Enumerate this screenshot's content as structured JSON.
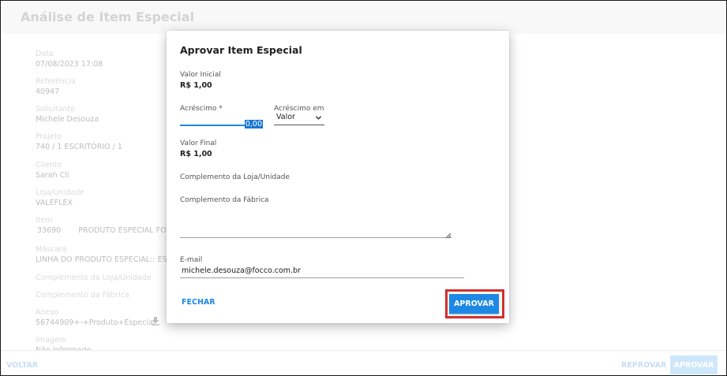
{
  "page": {
    "title": "Análise de Item Especial",
    "fields": [
      {
        "label": "Data",
        "value": "07/08/2023 17:08"
      },
      {
        "label": "Referência",
        "value": "40947"
      },
      {
        "label": "Solicitante",
        "value": "Michele Desouza"
      },
      {
        "label": "Projeto",
        "value": "740 / 1 ESCRITÓRIO / 1"
      },
      {
        "label": "Cliente",
        "value": "Sarah Cli"
      },
      {
        "label": "Loja/Unidade",
        "value": "VALEFLEX"
      }
    ],
    "item": {
      "label": "Item",
      "code": "33690",
      "name": "PRODUTO ESPECIAL FOCCO"
    },
    "mascara": {
      "label": "Máscara",
      "value": "LINHA DO PRODUTO ESPECIAL:: ESPE"
    },
    "complemento_loja": {
      "label": "Complemento da Loja/Unidade"
    },
    "complemento_fabrica": {
      "label": "Complemento da Fábrica"
    },
    "anexo": {
      "label": "Anexo",
      "value": "56744909+-+Produto+Especial"
    },
    "imagem": {
      "label": "Imagem",
      "value": "Não Informado"
    },
    "footer": {
      "voltar_label": "VOLTAR",
      "reprovar_label": "REPROVAR",
      "aprovar_label": "APROVAR"
    }
  },
  "dialog": {
    "title": "Aprovar Item Especial",
    "valor_inicial": {
      "label": "Valor Inicial",
      "value": "R$ 1,00"
    },
    "acrescimo": {
      "label": "Acréscimo *",
      "value": "0,00"
    },
    "acrescimo_em": {
      "label": "Acréscimo em",
      "selected": "Valor"
    },
    "valor_final": {
      "label": "Valor Final",
      "value": "R$ 1,00"
    },
    "complemento_loja_label": "Complemento da Loja/Unidade",
    "complemento_fabrica_label": "Complemento da Fábrica",
    "email": {
      "label": "E-mail",
      "value": "michele.desouza@focco.com.br"
    },
    "fechar_label": "FECHAR",
    "aprovar_label": "APROVAR"
  },
  "colors": {
    "accent": "#1e88e5",
    "highlight": "#d32f2f"
  }
}
